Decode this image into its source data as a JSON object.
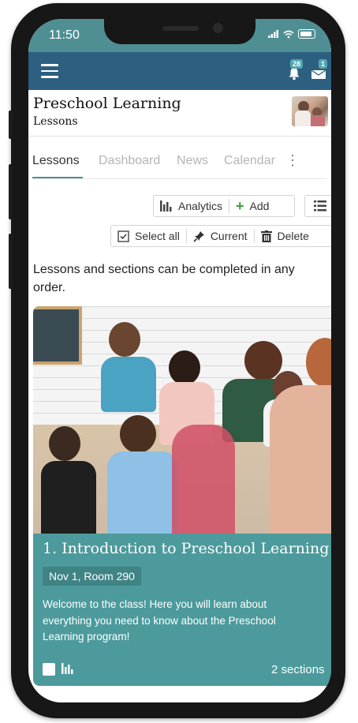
{
  "status_bar": {
    "time": "11:50"
  },
  "app_bar": {
    "menu_icon": "hamburger-menu-icon",
    "notifications_badge": "28",
    "messages_badge": "1",
    "accent_color": "#2d5f80"
  },
  "header": {
    "title": "Preschool Learning",
    "subtitle": "Lessons"
  },
  "tabs": [
    {
      "label": "Lessons",
      "active": true
    },
    {
      "label": "Dashboard",
      "active": false
    },
    {
      "label": "News",
      "active": false
    },
    {
      "label": "Calendar",
      "active": false
    }
  ],
  "toolbar": {
    "analytics_label": "Analytics",
    "add_label": "Add",
    "select_all_label": "Select all",
    "current_label": "Current",
    "delete_label": "Delete"
  },
  "intro_text": "Lessons and sections can be completed in any order.",
  "lesson": {
    "title": "1. Introduction to Preschool Learning",
    "date_room": "Nov 1, Room 290",
    "description": "Welcome to the class! Here you will learn about everything you need to know about the Preschool Learning program!",
    "sections": "2 sections",
    "card_color": "#4c9a9c"
  }
}
